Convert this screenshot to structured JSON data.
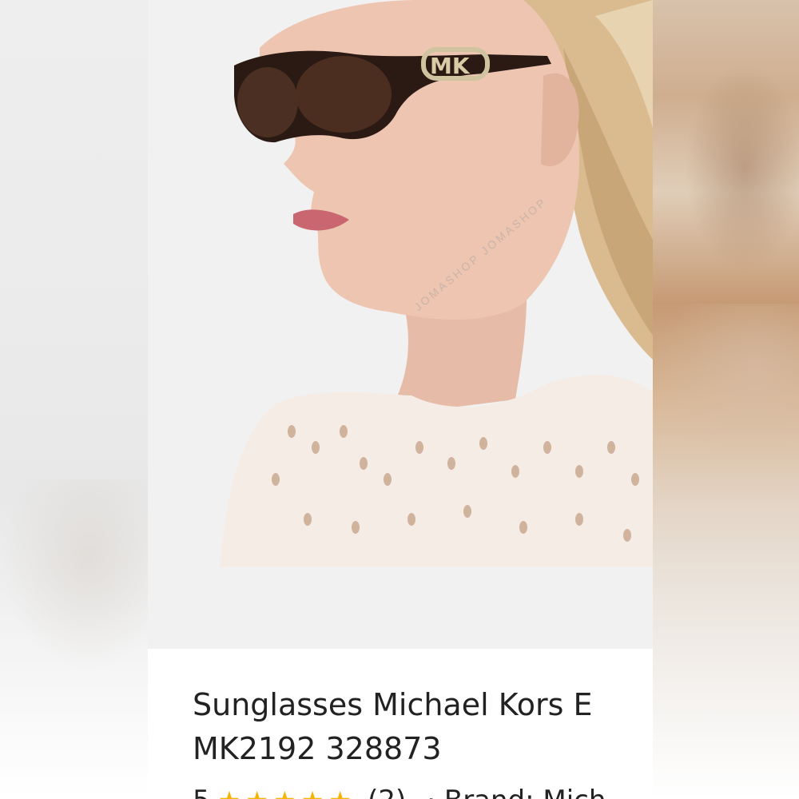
{
  "product": {
    "title_line1": "Sunglasses Michael Kors E",
    "title_line2": "MK2192 328873",
    "rating_value": "5",
    "rating_count": "(2)",
    "brand_text": "· Brand: Mich",
    "stars": 5
  },
  "image": {
    "watermark": "JOMASHOP JOMASHOP",
    "alt": "Woman wearing tortoise cat-eye sunglasses with MK logo on temple"
  },
  "colors": {
    "star": "#f4b400",
    "text": "#222222",
    "photo_bg": "#f1f1f1"
  }
}
